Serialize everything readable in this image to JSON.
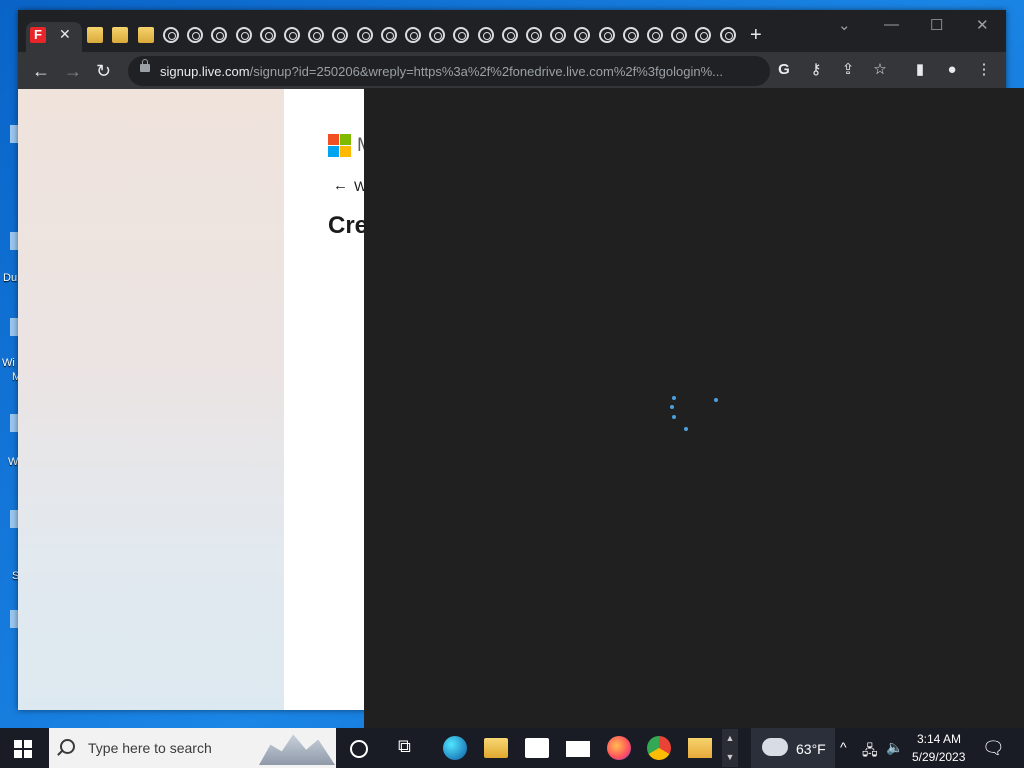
{
  "browser": {
    "active_tab_close": "✕",
    "new_tab": "+",
    "window_controls": [
      "⌄",
      "—",
      "☐",
      "✕"
    ],
    "url_host": "signup.live.com",
    "url_path": "/signup?id=250206&wreply=https%3a%2f%2fonedrive.live.com%2f%3fgologin%..."
  },
  "page": {
    "brand_letter": "M",
    "back_label": "W",
    "heading": "Cre",
    "ms_colors": [
      "#f25022",
      "#7fba00",
      "#00a4ef",
      "#ffb900"
    ]
  },
  "desktop": {
    "icon_labels": [
      "Du",
      "Wi",
      "M",
      "W",
      "S"
    ]
  },
  "taskbar": {
    "search_placeholder": "Type here to search",
    "temperature": "63°F",
    "time": "3:14 AM",
    "date": "5/29/2023"
  }
}
